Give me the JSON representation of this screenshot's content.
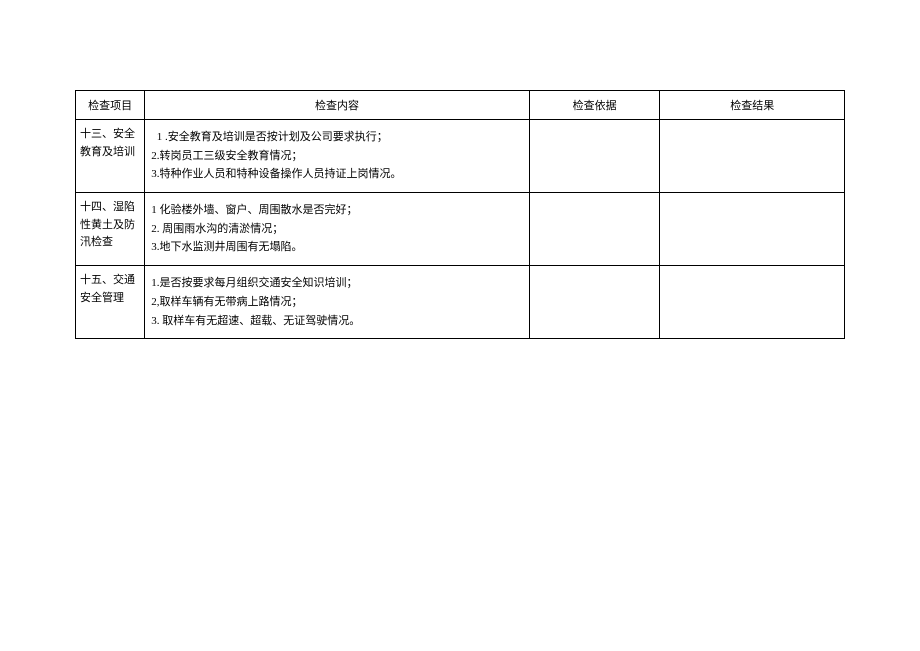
{
  "headers": {
    "col1": "检查项目",
    "col2": "检查内容",
    "col3": "检查依据",
    "col4": "检查结果"
  },
  "rows": [
    {
      "item": "十三、安全教育及培训",
      "lines": [
        "1   .安全教育及培训是否按计划及公司要求执行；",
        "2.转岗员工三级安全教育情况；",
        "3.特种作业人员和特种设备操作人员持证上岗情况。"
      ],
      "basis": "",
      "result": ""
    },
    {
      "item": "十四、湿陷性黄土及防汛检查",
      "lines": [
        "1 化验楼外墙、窗户、周围散水是否完好；",
        "2. 周围雨水沟的清淤情况；",
        "3.地下水监测井周围有无塌陷。"
      ],
      "basis": "",
      "result": ""
    },
    {
      "item": "十五、交通安全管理",
      "lines": [
        "1.是否按要求每月组织交通安全知识培训；",
        "2,取样车辆有无带病上路情况；",
        "3. 取样车有无超速、超载、无证驾驶情况。"
      ],
      "basis": "",
      "result": ""
    }
  ]
}
